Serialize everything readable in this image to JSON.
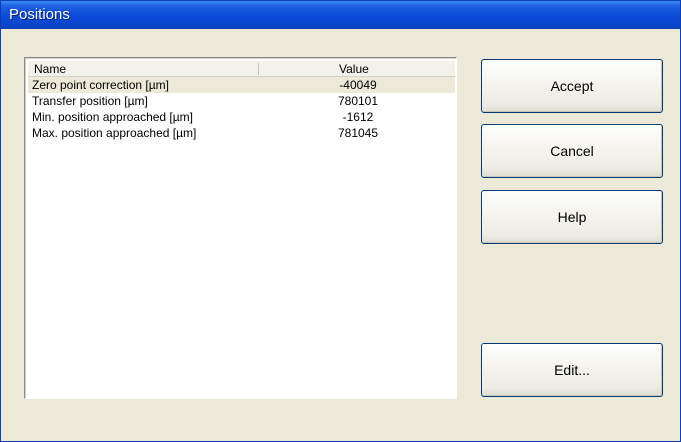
{
  "window": {
    "title": "Positions"
  },
  "list": {
    "columns": {
      "name": "Name",
      "value": "Value"
    },
    "rows": [
      {
        "name": "Zero point correction [µm]",
        "value": "-40049"
      },
      {
        "name": "Transfer position [µm]",
        "value": "780101"
      },
      {
        "name": "Min. position approached [µm]",
        "value": "-1612"
      },
      {
        "name": "Max. position approached [µm]",
        "value": "781045"
      }
    ]
  },
  "buttons": {
    "accept": "Accept",
    "cancel": "Cancel",
    "help": "Help",
    "edit": "Edit..."
  }
}
